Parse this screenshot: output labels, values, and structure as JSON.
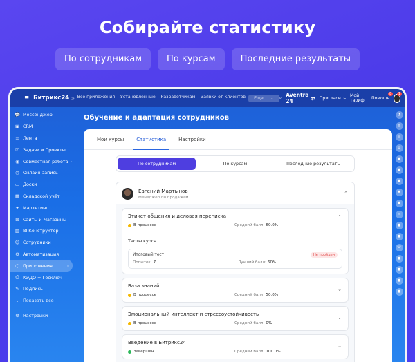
{
  "headline": "Собирайте статистику",
  "promo_tabs": [
    "По сотрудникам",
    "По курсам",
    "Последние результаты"
  ],
  "app": {
    "logo": "Битрикс24",
    "top_nav": [
      "Все приложения",
      "Установленные",
      "Разработчикам",
      "Заявки от клиентов",
      "Еще"
    ],
    "company": "Aventra 24",
    "invite": "Пригласить",
    "plan": "Мой тариф",
    "help": "Помощь",
    "help_badge": "8",
    "avatar_badge": "1"
  },
  "sidebar": {
    "items": [
      {
        "label": "Мессенджер",
        "icon": "💬"
      },
      {
        "label": "CRM",
        "icon": "▣"
      },
      {
        "label": "Лента",
        "icon": "≡"
      },
      {
        "label": "Задачи и Проекты",
        "icon": "☑"
      },
      {
        "label": "Совместная работа",
        "icon": "◉"
      },
      {
        "label": "Онлайн-запись",
        "icon": "◷"
      },
      {
        "label": "Доски",
        "icon": "▭"
      },
      {
        "label": "Складской учёт",
        "icon": "▦"
      },
      {
        "label": "Маркетинг",
        "icon": "✦"
      },
      {
        "label": "Сайты и Магазины",
        "icon": "⊞"
      },
      {
        "label": "BI Конструктор",
        "icon": "▥"
      },
      {
        "label": "Сотрудники",
        "icon": "☺"
      },
      {
        "label": "Автоматизация",
        "icon": "⚙"
      },
      {
        "label": "Приложения",
        "icon": "⬡"
      },
      {
        "label": "КЭДО + Госключ",
        "icon": "⎙"
      },
      {
        "label": "Подпись",
        "icon": "✎"
      },
      {
        "label": "Показать все",
        "icon": "⌄"
      },
      {
        "label": "Настройки",
        "icon": "⚙"
      }
    ]
  },
  "page_title": "Обучение и адаптация сотрудников",
  "panel_tabs": [
    "Мои курсы",
    "Статистика",
    "Настройки"
  ],
  "segments": [
    "По сотрудникам",
    "По курсам",
    "Последние результаты"
  ],
  "employee": {
    "name": "Евгений Мартынов",
    "role": "Менеджер по продажам"
  },
  "labels": {
    "avg_score": "Средний балл:",
    "tests_title": "Тесты курса",
    "attempts": "Попыток:",
    "best_score": "Лучший балл:"
  },
  "courses": [
    {
      "title": "Этикет общения и деловая переписка",
      "status": "В процессе",
      "status_color": "#f5b800",
      "avg": "60.0%",
      "test": {
        "name": "Итоговый тест",
        "badge": "Не пройден",
        "attempts": "7",
        "best": "60%"
      }
    },
    {
      "title": "База знаний",
      "status": "В процессе",
      "status_color": "#f5b800",
      "avg": "50.0%"
    },
    {
      "title": "Эмоциональный интеллект и стрессоустойчивость",
      "status": "В процессе",
      "status_color": "#f5b800",
      "avg": "0%"
    },
    {
      "title": "Введение в Битрикс24",
      "status": "Завершен",
      "status_color": "#2db85a",
      "avg": "100.0%"
    }
  ]
}
